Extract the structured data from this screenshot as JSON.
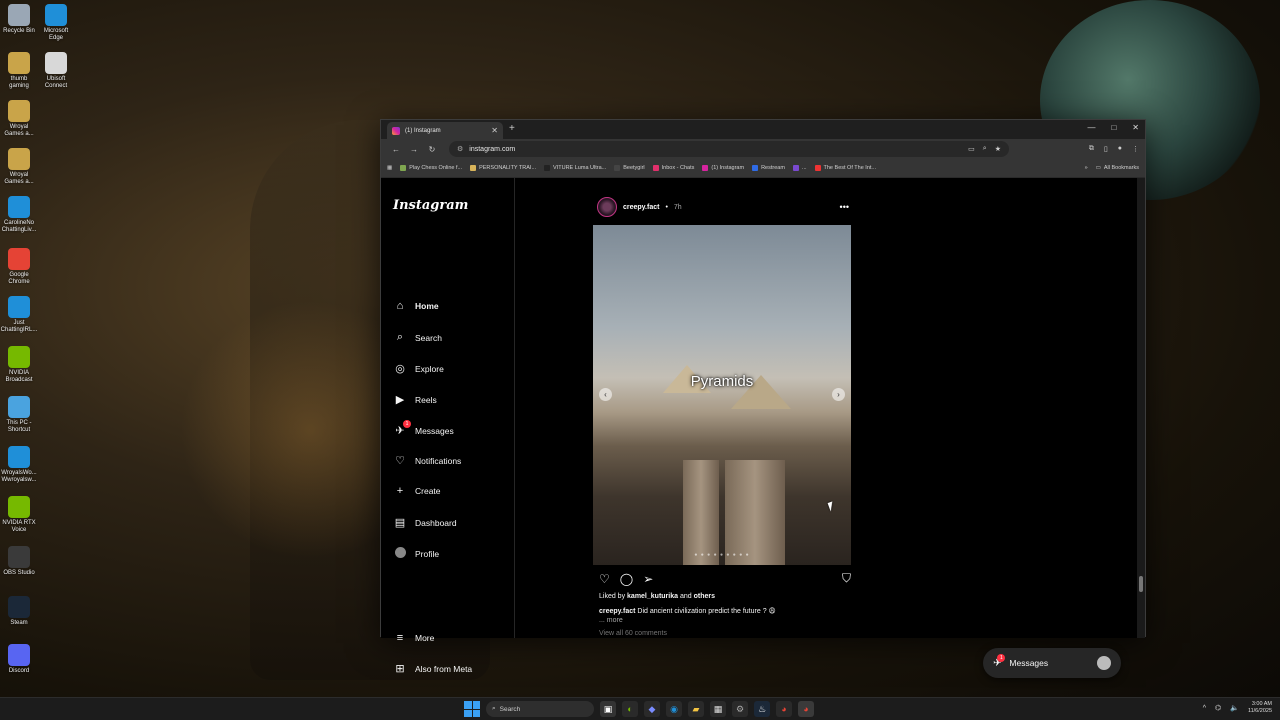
{
  "desktop": {
    "icons": [
      {
        "label": "Recycle Bin",
        "icon": "recycle-bin-icon",
        "color": "#9aa7b5"
      },
      {
        "label": "Microsoft Edge",
        "icon": "edge-icon",
        "color": "#1f8fd8"
      },
      {
        "label": "Ubisoft Connect",
        "icon": "ubisoft-icon",
        "color": "#d8d8d8"
      },
      {
        "label": "thumb gaming",
        "icon": "folder-icon",
        "color": "#c9a449"
      },
      {
        "label": "Wroyal Games a...",
        "icon": "folder-icon",
        "color": "#c9a449"
      },
      {
        "label": "Wroyal Games a...",
        "icon": "folder-icon",
        "color": "#c9a449"
      },
      {
        "label": "CarolineNo ChattingLiv...",
        "icon": "edge-icon",
        "color": "#1f8fd8"
      },
      {
        "label": "Google Chrome",
        "icon": "chrome-icon",
        "color": "#e54335"
      },
      {
        "label": "Just ChattingIRL...",
        "icon": "edge-icon",
        "color": "#1f8fd8"
      },
      {
        "label": "NVIDIA Broadcast",
        "icon": "nvidia-icon",
        "color": "#76b900"
      },
      {
        "label": "This PC - Shortcut",
        "icon": "monitor-icon",
        "color": "#4aa3df"
      },
      {
        "label": "WroyalsWo... Wwroyalsw...",
        "icon": "edge-icon",
        "color": "#1f8fd8"
      },
      {
        "label": "NVIDIA RTX Voice",
        "icon": "nvidia-icon",
        "color": "#76b900"
      },
      {
        "label": "OBS Studio",
        "icon": "obs-icon",
        "color": "#3a3a3a"
      },
      {
        "label": "Steam",
        "icon": "steam-icon",
        "color": "#1b2838"
      },
      {
        "label": "Discord",
        "icon": "discord-icon",
        "color": "#5865f2"
      }
    ]
  },
  "browser": {
    "tab_title": "(1) Instagram",
    "new_tab": "+",
    "url": "instagram.com",
    "bookmarks": [
      {
        "label": "Play Chess Online f...",
        "color": "#7fa650"
      },
      {
        "label": "PERSONALITY TRAI...",
        "color": "#d8b45a"
      },
      {
        "label": "VITURE Luma Ultra...",
        "color": "#222222"
      },
      {
        "label": "Beetygirl",
        "color": "#444444"
      },
      {
        "label": "Inbox - Chats",
        "color": "#e1306c"
      },
      {
        "label": "(1) Instagram",
        "color": "#d6249f"
      },
      {
        "label": "Restream",
        "color": "#2f6be6"
      },
      {
        "label": "...",
        "color": "#7a4ad0"
      },
      {
        "label": "The Best Of The Int...",
        "color": "#e33"
      }
    ],
    "all_bookmarks": "All Bookmarks"
  },
  "instagram": {
    "logo": "Instagram",
    "nav": [
      {
        "label": "Home",
        "icon": "home-icon",
        "glyph": "⌂",
        "active": true
      },
      {
        "label": "Search",
        "icon": "search-icon",
        "glyph": "⌕"
      },
      {
        "label": "Explore",
        "icon": "compass-icon",
        "glyph": "◎"
      },
      {
        "label": "Reels",
        "icon": "reels-icon",
        "glyph": "▶"
      },
      {
        "label": "Messages",
        "icon": "messenger-icon",
        "glyph": "✈",
        "badge": "1"
      },
      {
        "label": "Notifications",
        "icon": "heart-icon",
        "glyph": "♡"
      },
      {
        "label": "Create",
        "icon": "plus-icon",
        "glyph": "+"
      },
      {
        "label": "Dashboard",
        "icon": "dashboard-icon",
        "glyph": "▤"
      },
      {
        "label": "Profile",
        "icon": "avatar"
      },
      {
        "label": "More",
        "icon": "menu-icon",
        "glyph": "≡"
      },
      {
        "label": "Also from Meta",
        "icon": "meta-apps-icon",
        "glyph": "⊞"
      }
    ],
    "post": {
      "username": "creepy.fact",
      "separator": "•",
      "time": "7h",
      "media_caption": "Pyramids",
      "liked_prefix": "Liked by",
      "liked_user": "kamel_kuturika",
      "liked_and": "and",
      "liked_others": "others",
      "caption_user": "creepy.fact",
      "caption_text": "Did ancient civilization predict the future ? 😩",
      "more": "... more",
      "view_comments": "View all 60 comments"
    },
    "messages_pill": {
      "label": "Messages",
      "badge": "1"
    }
  },
  "taskbar": {
    "search_placeholder": "Search",
    "time": "3:00 AM",
    "date": "11/6/2025"
  },
  "colors": {
    "accent_badge": "#ff3040",
    "instagram_bg": "#000000",
    "chrome_toolbar": "#353535"
  }
}
